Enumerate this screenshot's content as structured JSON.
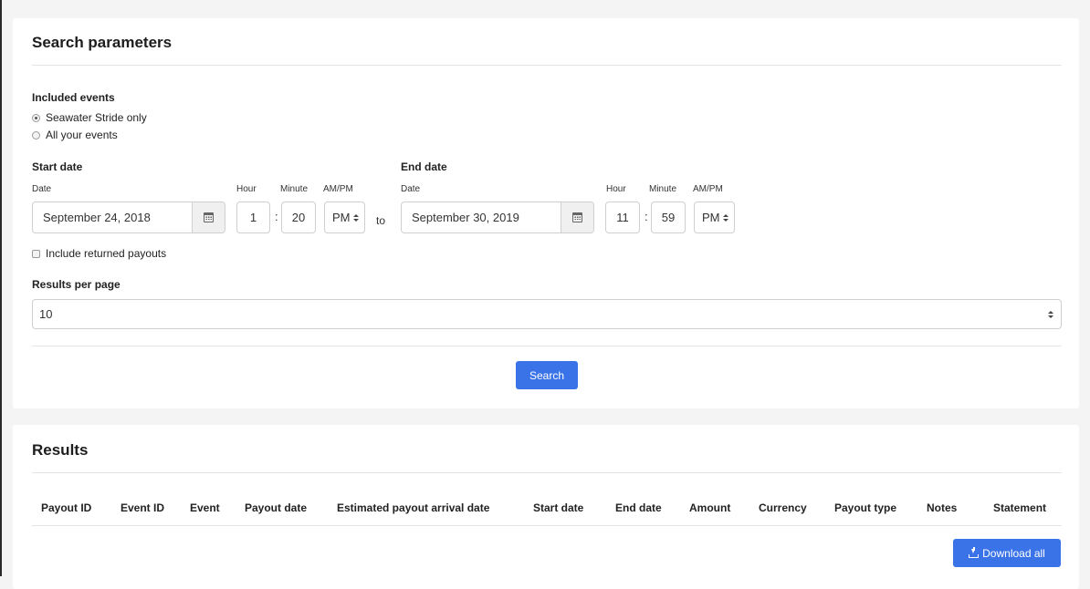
{
  "search_card": {
    "title": "Search parameters",
    "included_events": {
      "label": "Included events",
      "options": [
        {
          "label": "Seawater Stride only",
          "checked": true
        },
        {
          "label": "All your events",
          "checked": false
        }
      ]
    },
    "start": {
      "label": "Start date",
      "date_label": "Date",
      "hour_label": "Hour",
      "minute_label": "Minute",
      "ampm_label": "AM/PM",
      "date_value": "September 24, 2018",
      "hour_value": "1",
      "minute_value": "20",
      "ampm_value": "PM"
    },
    "to_text": "to",
    "end": {
      "label": "End date",
      "date_label": "Date",
      "hour_label": "Hour",
      "minute_label": "Minute",
      "ampm_label": "AM/PM",
      "date_value": "September 30, 2019",
      "hour_value": "11",
      "minute_value": "59",
      "ampm_value": "PM"
    },
    "time_separator": ":",
    "include_returned": {
      "label": "Include returned payouts",
      "checked": false
    },
    "results_per_page": {
      "label": "Results per page",
      "value": "10"
    },
    "search_button": "Search"
  },
  "results_card": {
    "title": "Results",
    "columns": [
      "Payout ID",
      "Event ID",
      "Event",
      "Payout date",
      "Estimated payout arrival date",
      "Start date",
      "End date",
      "Amount",
      "Currency",
      "Payout type",
      "Notes",
      "Statement"
    ],
    "download_button": "Download all"
  },
  "icons": {
    "calendar": "calendar-icon",
    "select_arrows": "chevron-up-down-icon",
    "download": "download-icon"
  },
  "colors": {
    "primary": "#3a73e8",
    "page_background": "#f4f4f4",
    "card_background": "#ffffff"
  }
}
